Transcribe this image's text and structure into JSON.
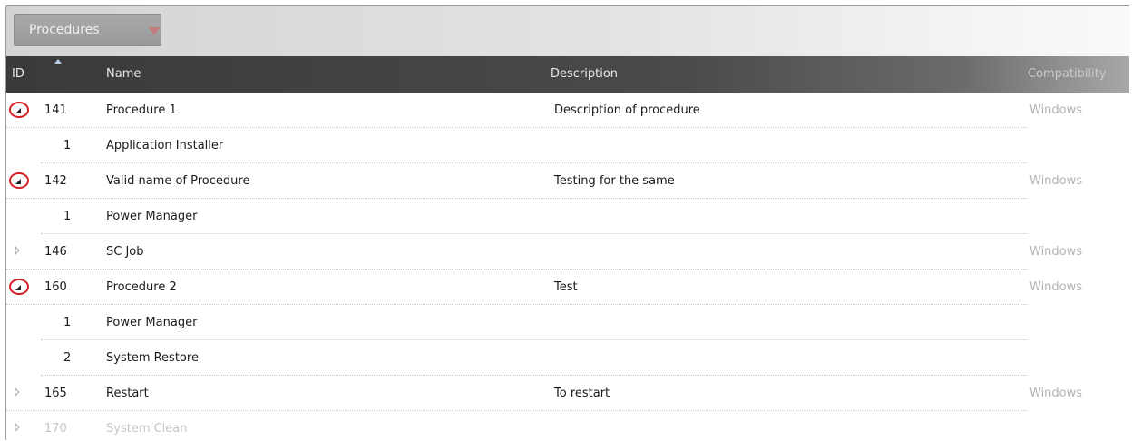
{
  "toolbar": {
    "dropdown_label": "Procedures",
    "dropdown_arrow_icon": "triangle-down-icon"
  },
  "columns": {
    "id": "ID",
    "name": "Name",
    "description": "Description",
    "compatibility": "Compatibility"
  },
  "rows": [
    {
      "id": "141",
      "name": "Procedure 1",
      "description": "Description of procedure",
      "compatibility": "Windows",
      "level": 0,
      "expander": "expanded"
    },
    {
      "id": "1",
      "name": "Application Installer",
      "description": "",
      "compatibility": "",
      "level": 1,
      "expander": "none"
    },
    {
      "id": "142",
      "name": "Valid name of Procedure",
      "description": "Testing for the same",
      "compatibility": "Windows",
      "level": 0,
      "expander": "expanded"
    },
    {
      "id": "1",
      "name": "Power Manager",
      "description": "",
      "compatibility": "",
      "level": 1,
      "expander": "none"
    },
    {
      "id": "146",
      "name": "SC Job",
      "description": "",
      "compatibility": "Windows",
      "level": 0,
      "expander": "collapsed"
    },
    {
      "id": "160",
      "name": "Procedure 2",
      "description": "Test",
      "compatibility": "Windows",
      "level": 0,
      "expander": "expanded"
    },
    {
      "id": "1",
      "name": "Power Manager",
      "description": "",
      "compatibility": "",
      "level": 1,
      "expander": "none"
    },
    {
      "id": "2",
      "name": "System Restore",
      "description": "",
      "compatibility": "",
      "level": 1,
      "expander": "none"
    },
    {
      "id": "165",
      "name": "Restart",
      "description": "To restart",
      "compatibility": "Windows",
      "level": 0,
      "expander": "collapsed"
    },
    {
      "id": "170",
      "name": "System Clean",
      "description": "",
      "compatibility": "",
      "level": 0,
      "expander": "collapsed",
      "faded": true
    }
  ]
}
